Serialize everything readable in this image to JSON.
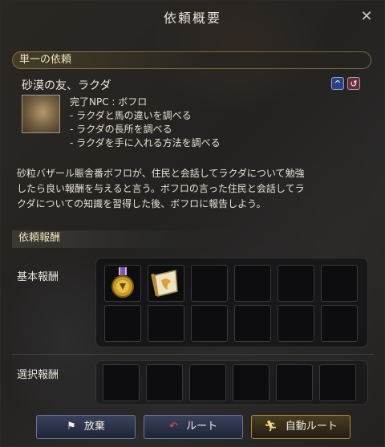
{
  "window": {
    "title": "依頼概要"
  },
  "sections": {
    "quest_type": "単一の依頼",
    "rewards": "依頼報酬"
  },
  "quest": {
    "title": "砂漠の友、ラクダ",
    "complete_npc": "完了NPC : ボフロ",
    "objectives": [
      "- ラクダと馬の違いを調べる",
      "- ラクダの長所を調べる",
      "- ラクダを手に入れる方法を調べる"
    ],
    "description": [
      "砂粒バザール賑舎番ボフロが、住民と会話してラクダについて勉強",
      "したら良い報酬を与えると言う。ボフロの言った住民と会話してラ",
      "クダについての知識を習得した後、ボフロに報告しよう。"
    ]
  },
  "rewards": {
    "basic_label": "基本報酬",
    "select_label": "選択報酬",
    "basic_items": [
      "medal-icon",
      "scroll-icon",
      "",
      "",
      "",
      "",
      "",
      "",
      "",
      "",
      "",
      ""
    ],
    "select_items": [
      "",
      "",
      "",
      "",
      "",
      ""
    ]
  },
  "buttons": {
    "abandon": "放棄",
    "route": "ルート",
    "auto_route": "自動ルート"
  },
  "colors": {
    "accent": "#c8a24a",
    "button_blue": "#2f3852"
  }
}
